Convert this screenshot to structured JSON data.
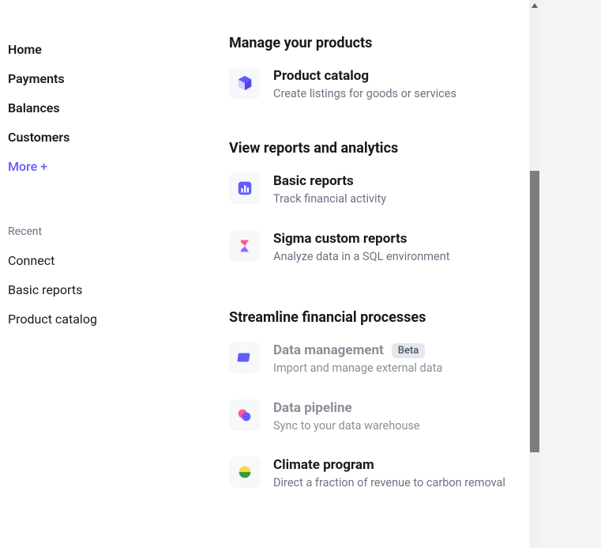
{
  "sidebar": {
    "nav": [
      {
        "label": "Home"
      },
      {
        "label": "Payments"
      },
      {
        "label": "Balances"
      },
      {
        "label": "Customers"
      }
    ],
    "more_label": "More +",
    "recent_label": "Recent",
    "recent": [
      {
        "label": "Connect"
      },
      {
        "label": "Basic reports"
      },
      {
        "label": "Product catalog"
      }
    ]
  },
  "content": {
    "sections": [
      {
        "title": "Manage your products",
        "items": [
          {
            "icon": "cube-icon",
            "title": "Product catalog",
            "desc": "Create listings for goods or services",
            "disabled": false
          }
        ]
      },
      {
        "title": "View reports and analytics",
        "items": [
          {
            "icon": "bar-chart-icon",
            "title": "Basic reports",
            "desc": "Track financial activity",
            "disabled": false
          },
          {
            "icon": "sigma-icon",
            "title": "Sigma custom reports",
            "desc": "Analyze data in a SQL environment",
            "disabled": false
          }
        ]
      },
      {
        "title": "Streamline financial processes",
        "items": [
          {
            "icon": "data-mgmt-icon",
            "title": "Data management",
            "desc": "Import and manage external data",
            "badge": "Beta",
            "disabled": true
          },
          {
            "icon": "pipeline-icon",
            "title": "Data pipeline",
            "desc": "Sync to your data warehouse",
            "disabled": true
          },
          {
            "icon": "climate-icon",
            "title": "Climate program",
            "desc": "Direct a fraction of revenue to carbon removal",
            "disabled": false
          }
        ]
      }
    ]
  }
}
